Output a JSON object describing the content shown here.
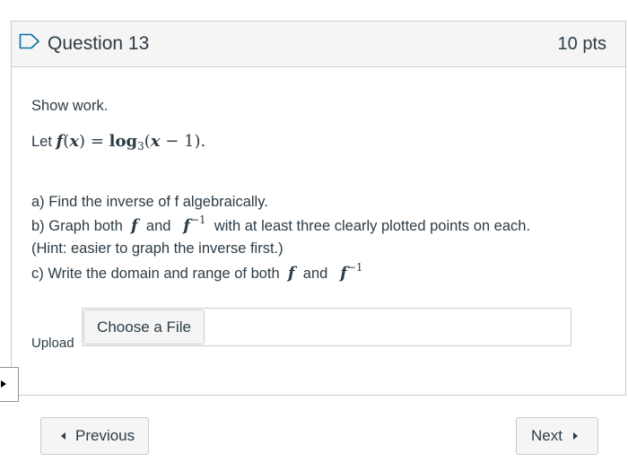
{
  "question": {
    "title": "Question 13",
    "points": "10 pts",
    "show_work": "Show work.",
    "let_prefix": "Let",
    "function_def": {
      "f": "f",
      "lparen": "(",
      "x": "x",
      "rparen": ")",
      "equals": "=",
      "log": "log",
      "base": "3",
      "arg_open": "(",
      "arg": "x",
      "minus": "−",
      "one": "1",
      "arg_close": ")",
      "period": "."
    },
    "part_a": "a) Find the inverse of f algebraically.",
    "part_b": {
      "prefix": "b) Graph both",
      "f": "f",
      "and": "and",
      "finv": "f",
      "sup": "−1",
      "suffix": "with at least three clearly plotted points on each."
    },
    "hint": "(Hint: easier to graph the inverse first.)",
    "part_c": {
      "prefix": "c) Write the domain and range of both",
      "f": "f",
      "and": "and",
      "finv": "f",
      "sup": "−1"
    }
  },
  "upload": {
    "label": "Upload",
    "button": "Choose a File"
  },
  "nav": {
    "previous": "Previous",
    "next": "Next"
  },
  "icons": {
    "flag": "bookmark-flag-icon",
    "prev": "caret-left-icon",
    "next": "caret-right-icon",
    "tab": "caret-right-icon"
  },
  "colors": {
    "text": "#2d3b45",
    "border": "#c7cdd1",
    "header_bg": "#f5f5f5",
    "flag_blue": "#0770a3"
  }
}
